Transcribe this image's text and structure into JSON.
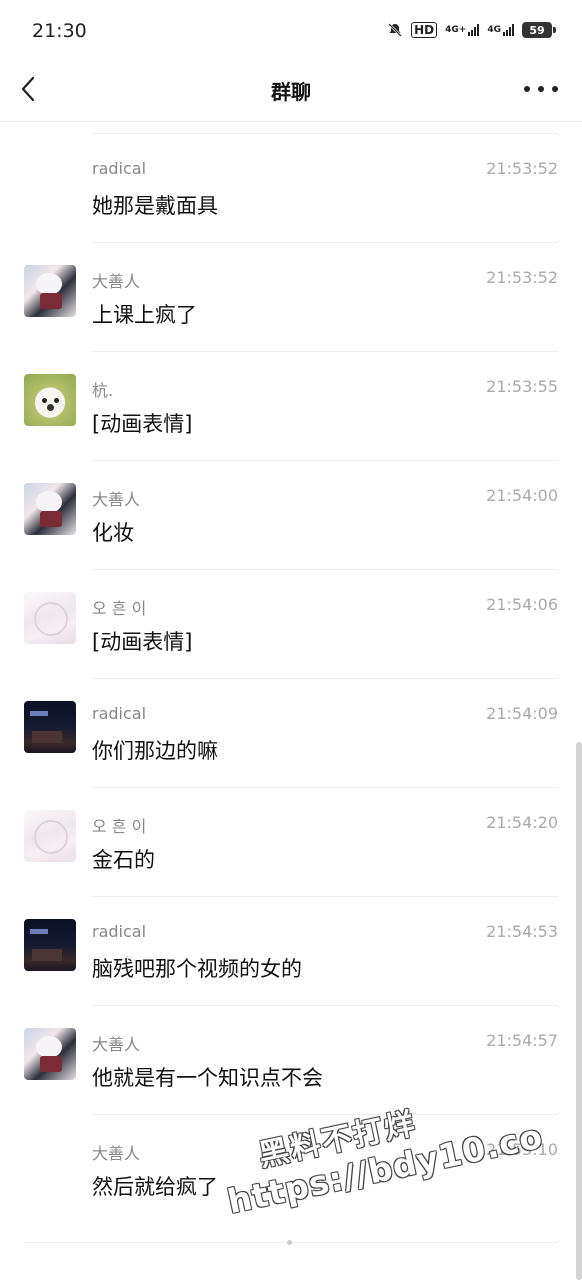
{
  "status_bar": {
    "time": "21:30",
    "hd_label": "HD",
    "network_1": "4G+",
    "network_2": "4G",
    "battery": "59"
  },
  "nav": {
    "title": "群聊"
  },
  "messages": [
    {
      "sender": "radical",
      "time": "21:53:52",
      "text": "她那是戴面具"
    },
    {
      "sender": "大善人",
      "time": "21:53:52",
      "text": "上课上疯了"
    },
    {
      "sender": "杭.",
      "time": "21:53:55",
      "text": "[动画表情]"
    },
    {
      "sender": "大善人",
      "time": "21:54:00",
      "text": "化妆"
    },
    {
      "sender": "오 흔 이",
      "time": "21:54:06",
      "text": "[动画表情]"
    },
    {
      "sender": "radical",
      "time": "21:54:09",
      "text": "你们那边的嘛"
    },
    {
      "sender": "오 흔 이",
      "time": "21:54:20",
      "text": "金石的"
    },
    {
      "sender": "radical",
      "time": "21:54:53",
      "text": "脑残吧那个视频的女的"
    },
    {
      "sender": "大善人",
      "time": "21:54:57",
      "text": "他就是有一个知识点不会"
    },
    {
      "sender": "大善人",
      "time": "21:55:10",
      "text": "然后就给疯了"
    }
  ],
  "watermark": {
    "line1": "黑料不打烊",
    "line2": "https://bdy10.co"
  }
}
